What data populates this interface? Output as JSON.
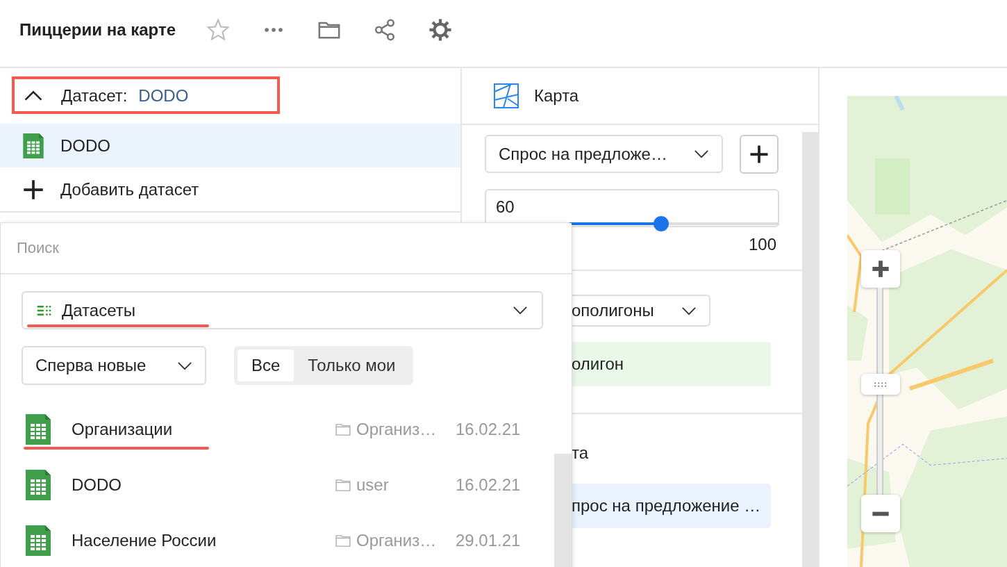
{
  "header": {
    "title": "Пиццерии на карте"
  },
  "dataset_panel": {
    "label": "Датасет:",
    "value": "DODO",
    "expanded": true,
    "datasets": [
      {
        "name": "DODO",
        "selected": true
      }
    ],
    "add_label": "Добавить датасет"
  },
  "visualization": {
    "type_label": "Карта",
    "layer_select": "Спрос на предложе…",
    "opacity": {
      "value": "60",
      "level": 0.6,
      "max": "100"
    },
    "geo_select": "ополигоны",
    "geo_field": "олигон",
    "section_label": "та",
    "color_field": "прос на предложение …"
  },
  "picker": {
    "search": {
      "placeholder": "Поиск"
    },
    "type_select": "Датасеты",
    "sort_select": "Сперва новые",
    "filters": [
      {
        "label": "Все",
        "selected": true
      },
      {
        "label": "Только мои",
        "selected": false
      }
    ],
    "items": [
      {
        "name": "Организации",
        "folder": "Организ…",
        "date": "16.02.21"
      },
      {
        "name": "DODO",
        "folder": "user",
        "date": "16.02.21"
      },
      {
        "name": "Население России",
        "folder": "Организ…",
        "date": "29.01.21"
      }
    ]
  }
}
